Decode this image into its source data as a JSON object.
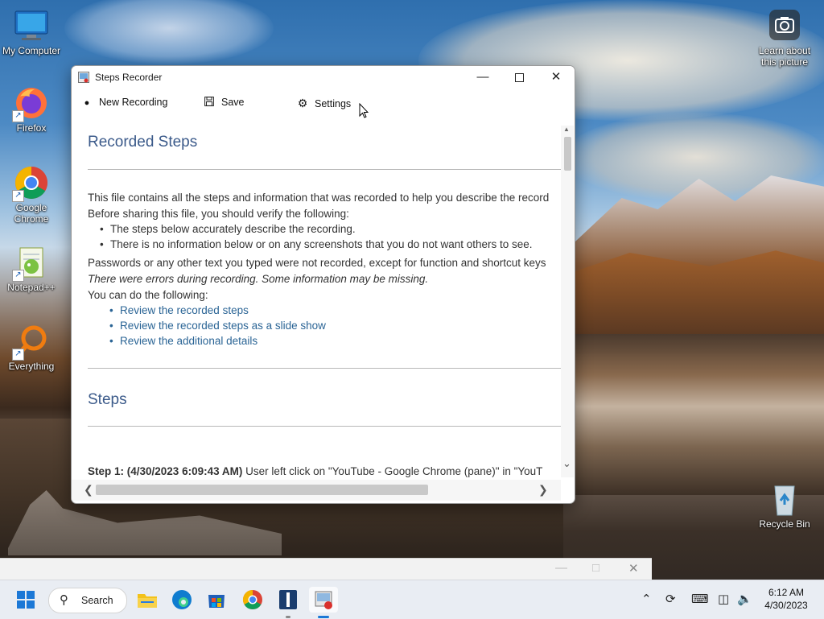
{
  "desktop": {
    "icons": [
      {
        "label": "My Computer"
      },
      {
        "label": "Firefox"
      },
      {
        "label": "Google Chrome"
      },
      {
        "label": "Notepad++"
      },
      {
        "label": "Everything"
      },
      {
        "label": "Recycle Bin"
      }
    ],
    "learn_label": "Learn about this picture"
  },
  "window": {
    "title": "Steps Recorder",
    "toolbar": {
      "new_recording": "New Recording",
      "save": "Save",
      "settings": "Settings"
    },
    "document": {
      "heading_recorded": "Recorded Steps",
      "intro": "This file contains all the steps and information that was recorded to help you describe the record",
      "verify": "Before sharing this file, you should verify the following:",
      "checks": [
        "The steps below accurately describe the recording.",
        "There is no information below or on any screenshots that you do not want others to see."
      ],
      "passwords": "Passwords or any other text you typed were not recorded, except for function and shortcut keys",
      "errors": "There were errors during recording. Some information may be missing.",
      "can_do": "You can do the following:",
      "links": [
        "Review the recorded steps",
        "Review the recorded steps as a slide show",
        "Review the additional details"
      ],
      "heading_steps": "Steps",
      "step1_label": "Step 1: (4/30/2023 6:09:43 AM)",
      "step1_text": " User left click on \"YouTube - Google Chrome (pane)\" in \"YouT"
    }
  },
  "taskbar": {
    "search_label": "Search",
    "time": "6:12 AM",
    "date": "4/30/2023"
  },
  "colors": {
    "heading": "#3b5a8a",
    "link": "#2a6495",
    "taskbar": "#e9edf3"
  }
}
